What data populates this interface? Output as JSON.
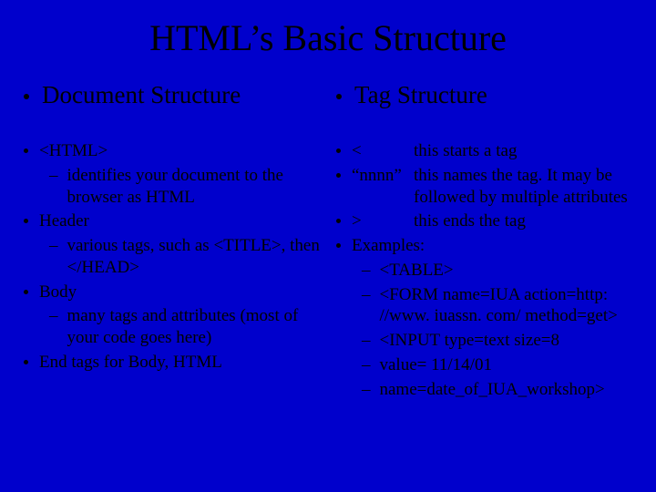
{
  "title": "HTML’s Basic Structure",
  "left": {
    "heading": "Document Structure",
    "i1": "<HTML>",
    "i1s1": "identifies your document to the browser as HTML",
    "i2": "Header",
    "i2s1": "various tags, such as <TITLE>, then </HEAD>",
    "i3": "Body",
    "i3s1": "many tags and attributes (most of your code goes here)",
    "i4": "End tags for Body, HTML"
  },
  "right": {
    "heading": "Tag Structure",
    "r1k": "<",
    "r1v": "this starts a tag",
    "r2k": "“nnnn”",
    "r2v": "this names the tag.  It may be followed by multiple attributes",
    "r3k": ">",
    "r3v": "this ends the tag",
    "r4": "Examples:",
    "r4s1": "<TABLE>",
    "r4s2": "<FORM name=IUA action=http: //www. iuassn. com/ method=get>",
    "r4s3": "<INPUT type=text size=8",
    "r4s4": "value= 11/14/01",
    "r4s5": "name=date_of_IUA_workshop>"
  }
}
